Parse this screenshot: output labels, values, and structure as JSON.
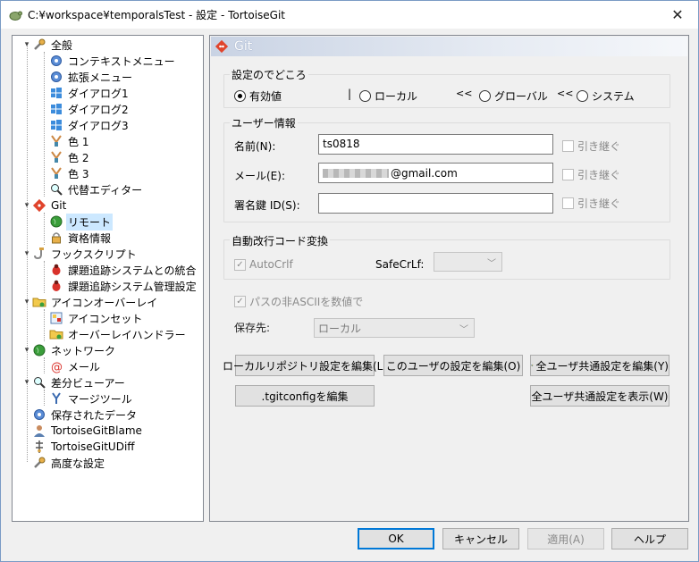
{
  "window": {
    "title": "C:¥workspace¥temporalsTest - 設定 - TortoiseGit",
    "close_glyph": "✕"
  },
  "tree": [
    {
      "label": "全般",
      "icon": "wrench-icon",
      "expander": "▾"
    },
    {
      "label": "コンテキストメニュー",
      "icon": "gear-icon"
    },
    {
      "label": "拡張メニュー",
      "icon": "gear-icon"
    },
    {
      "label": "ダイアログ1",
      "icon": "windows-icon"
    },
    {
      "label": "ダイアログ2",
      "icon": "windows-icon"
    },
    {
      "label": "ダイアログ3",
      "icon": "windows-icon"
    },
    {
      "label": "色 1",
      "icon": "paint-icon"
    },
    {
      "label": "色 2",
      "icon": "paint-icon"
    },
    {
      "label": "色 3",
      "icon": "paint-icon"
    },
    {
      "label": "代替エディター",
      "icon": "magnifier-icon"
    },
    {
      "label": "Git",
      "icon": "git-icon",
      "expander": "▾"
    },
    {
      "label": "リモート",
      "icon": "globe-icon",
      "selected": true
    },
    {
      "label": "資格情報",
      "icon": "lock-icon"
    },
    {
      "label": "フックスクリプト",
      "icon": "hook-icon",
      "expander": "▾"
    },
    {
      "label": "課題追跡システムとの統合",
      "icon": "bug-icon"
    },
    {
      "label": "課題追跡システム管理設定",
      "icon": "bug-icon"
    },
    {
      "label": "アイコンオーバーレイ",
      "icon": "folder-icon",
      "expander": "▾"
    },
    {
      "label": "アイコンセット",
      "icon": "iconset-icon"
    },
    {
      "label": "オーバーレイハンドラー",
      "icon": "folder-icon"
    },
    {
      "label": "ネットワーク",
      "icon": "globe-icon",
      "expander": "▾"
    },
    {
      "label": "メール",
      "icon": "at-icon"
    },
    {
      "label": "差分ビューアー",
      "icon": "magnifier-icon",
      "expander": "▾"
    },
    {
      "label": "マージツール",
      "icon": "merge-icon"
    },
    {
      "label": "保存されたデータ",
      "icon": "gear-icon"
    },
    {
      "label": "TortoiseGitBlame",
      "icon": "person-icon"
    },
    {
      "label": "TortoiseGitUDiff",
      "icon": "diff-icon"
    },
    {
      "label": "高度な設定",
      "icon": "wrench-icon"
    }
  ],
  "panel": {
    "header": "Git",
    "settings_location": {
      "title": "設定のでどころ",
      "effective": "有効値",
      "local": "ローカル",
      "global": "グローバル",
      "system": "システム",
      "separator": "|",
      "chevrons": "<<"
    },
    "user_info": {
      "title": "ユーザー情報",
      "name_label": "名前(N):",
      "name_value": "ts0818",
      "email_label": "メール(E):",
      "email_value": "@gmail.com",
      "signkey_label": "署名鍵 ID(S):",
      "signkey_value": "",
      "inherit_label": "引き継ぐ"
    },
    "autocrlf": {
      "title": "自動改行コード変換",
      "autocrlf_label": "AutoCrlf",
      "safecrlf_label": "SafeCrLf:",
      "safecrlf_value": ""
    },
    "non_ascii_label": "パスの非ASCIIを数値で",
    "save_to_label": "保存先:",
    "save_to_value": "ローカル",
    "buttons": {
      "edit_local": "ローカルリポジトリ設定を編集(L)",
      "edit_user": "このユーザの設定を編集(O)",
      "edit_all": "全ユーザ共通設定を編集(Y)",
      "edit_tgitconfig": ".tgitconfigを編集",
      "show_all": "全ユーザ共通設定を表示(W)"
    }
  },
  "footer": {
    "ok": "OK",
    "cancel": "キャンセル",
    "apply": "適用(A)",
    "help": "ヘルプ"
  },
  "colors": {
    "selection": "#cce8ff",
    "default_button_border": "#0078d7",
    "git_red": "#e0442c"
  }
}
